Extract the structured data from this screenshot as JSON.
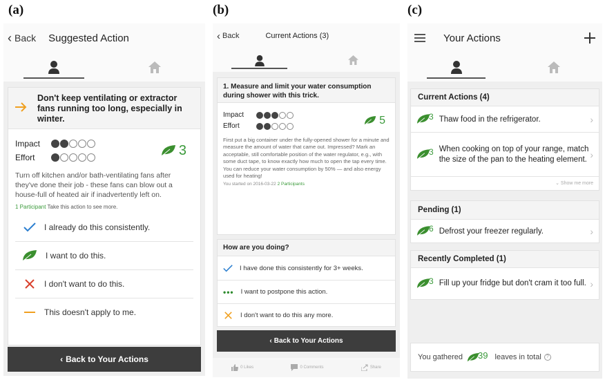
{
  "labels": {
    "a": "(a)",
    "b": "(b)",
    "c": "(c)"
  },
  "colors": {
    "accent_orange": "#f0a020",
    "leaf_green": "#3b8f2f",
    "check_blue": "#2c7fd0",
    "cross_red": "#d9402c",
    "dark_button": "#3d3d3d"
  },
  "a": {
    "back": "Back",
    "title": "Suggested Action",
    "headline": "Don't keep ventilating or extractor fans running too long, especially in winter.",
    "impact_label": "Impact",
    "impact": 2,
    "effort_label": "Effort",
    "effort": 1,
    "score": "3",
    "description": "Turn off kitchen and/or bath-ventilating fans after they've done their job - these fans can blow out a house-full of heated air if inadvertently left on.",
    "participants": "1 Participant",
    "participants_note": "Take this action to see more.",
    "options": [
      {
        "icon": "check-icon",
        "label": "I already do this consistently."
      },
      {
        "icon": "leaf-icon",
        "label": "I want to do this."
      },
      {
        "icon": "cross-icon",
        "label": "I don't want to do this."
      },
      {
        "icon": "dash-icon",
        "label": "This doesn't apply to me."
      }
    ],
    "bottom_button": "Back to Your Actions"
  },
  "b": {
    "back": "Back",
    "title": "Current Actions (3)",
    "headline": "1. Measure and limit your water consumption during shower with this trick.",
    "impact_label": "Impact",
    "impact": 3,
    "effort_label": "Effort",
    "effort": 2,
    "score": "5",
    "description": "First put a big container under the fully-opened shower for a minute and measure the amount of water that came out. Impressed? Mark an acceptable, still comfortable position of the water regulator, e.g., with some duct tape, to know exactly how much to open the tap every time. You can reduce your water consumption by 50% — and also energy used for heating!",
    "started": "You started on 2016-03-22",
    "participants": "2 Participants",
    "question": "How are you doing?",
    "options": [
      {
        "icon": "check-icon",
        "label": "I have done this consistently for 3+ weeks."
      },
      {
        "icon": "ellipsis-icon",
        "label": "I want to postpone this action."
      },
      {
        "icon": "cross-icon",
        "label": "I don't want to do this any more."
      }
    ],
    "bottom_button": "Back to Your Actions",
    "footer": {
      "likes": "0 Likes",
      "comments": "0 Comments",
      "share": "Share"
    }
  },
  "c": {
    "title": "Your Actions",
    "current": {
      "header": "Current Actions (4)",
      "items": [
        {
          "score": "3",
          "label": "Thaw food in the refrigerator."
        },
        {
          "score": "3",
          "label": "When cooking on top of your range, match the size of the pan to the heating element."
        }
      ],
      "show_more": "Show me more"
    },
    "pending": {
      "header": "Pending (1)",
      "items": [
        {
          "score": "6",
          "label": "Defrost your freezer regularly."
        }
      ]
    },
    "completed": {
      "header": "Recently Completed (1)",
      "items": [
        {
          "score": "3",
          "label": "Fill up your fridge but don't cram it too full."
        }
      ]
    },
    "gathered_prefix": "You gathered",
    "gathered_value": "39",
    "gathered_suffix": "leaves in total"
  }
}
